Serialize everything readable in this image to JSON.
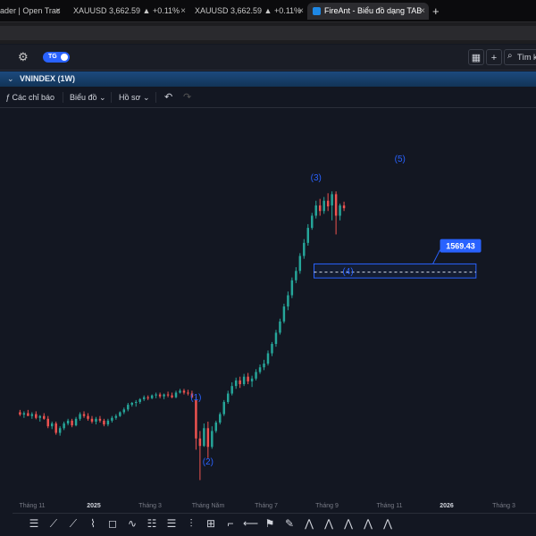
{
  "browser": {
    "tabs": [
      {
        "title": "ader | Open Trac",
        "active": false
      },
      {
        "title": "XAUUSD 3,662.59 ▲ +0.11%",
        "active": false
      },
      {
        "title": "XAUUSD 3,662.59 ▲ +0.11%",
        "active": false
      },
      {
        "title": "FireAnt - Biểu đồ dạng TAB",
        "active": true
      }
    ],
    "close_glyph": "×",
    "new_tab_glyph": "+"
  },
  "toolbar": {
    "toggle_label": "TG",
    "search_label": "Tìm k"
  },
  "symbol": {
    "name": "VNINDEX (1W)"
  },
  "chart_toolbar": {
    "indicators_label": "Các chỉ báo",
    "chart_label": "Biểu đồ",
    "profile_label": "Hồ sơ"
  },
  "chart_data": {
    "type": "candlestick",
    "price_label": "1569.43",
    "zone": {
      "top": 1587,
      "bottom": 1557
    },
    "wave_labels": [
      {
        "text": "(1)",
        "week": 44,
        "price": 1296,
        "color": "#2962ff"
      },
      {
        "text": "(2)",
        "week": 47,
        "price": 1158,
        "color": "#2962ff"
      },
      {
        "text": "(3)",
        "week": 74,
        "price": 1765,
        "color": "#2962ff"
      },
      {
        "text": "(4)",
        "week": 82,
        "price": 1565,
        "color": "#2962ff"
      },
      {
        "text": "(5)",
        "week": 95,
        "price": 1805,
        "color": "#2962ff"
      }
    ],
    "up_color": "#26a69a",
    "down_color": "#ef5350",
    "candles": [
      [
        0,
        1270,
        1275,
        1262,
        1265
      ],
      [
        1,
        1265,
        1272,
        1258,
        1268
      ],
      [
        2,
        1268,
        1275,
        1262,
        1262
      ],
      [
        3,
        1262,
        1270,
        1256,
        1266
      ],
      [
        4,
        1266,
        1272,
        1255,
        1258
      ],
      [
        5,
        1258,
        1264,
        1250,
        1262
      ],
      [
        6,
        1262,
        1268,
        1254,
        1256
      ],
      [
        7,
        1256,
        1262,
        1236,
        1240
      ],
      [
        8,
        1240,
        1250,
        1234,
        1246
      ],
      [
        9,
        1246,
        1250,
        1222,
        1226
      ],
      [
        10,
        1226,
        1240,
        1220,
        1236
      ],
      [
        11,
        1236,
        1250,
        1232,
        1246
      ],
      [
        12,
        1246,
        1256,
        1242,
        1252
      ],
      [
        13,
        1252,
        1256,
        1238,
        1242
      ],
      [
        14,
        1242,
        1260,
        1240,
        1256
      ],
      [
        15,
        1256,
        1270,
        1252,
        1266
      ],
      [
        16,
        1266,
        1272,
        1258,
        1262
      ],
      [
        17,
        1262,
        1268,
        1252,
        1256
      ],
      [
        18,
        1256,
        1262,
        1246,
        1250
      ],
      [
        19,
        1250,
        1260,
        1244,
        1256
      ],
      [
        20,
        1256,
        1262,
        1248,
        1252
      ],
      [
        21,
        1252,
        1256,
        1240,
        1244
      ],
      [
        22,
        1244,
        1256,
        1240,
        1252
      ],
      [
        23,
        1252,
        1262,
        1248,
        1258
      ],
      [
        24,
        1258,
        1266,
        1254,
        1262
      ],
      [
        25,
        1262,
        1272,
        1260,
        1270
      ],
      [
        26,
        1270,
        1280,
        1266,
        1276
      ],
      [
        27,
        1276,
        1290,
        1272,
        1286
      ],
      [
        28,
        1286,
        1292,
        1282,
        1290
      ],
      [
        29,
        1290,
        1296,
        1282,
        1292
      ],
      [
        30,
        1292,
        1300,
        1288,
        1298
      ],
      [
        31,
        1298,
        1306,
        1294,
        1302
      ],
      [
        32,
        1302,
        1306,
        1296,
        1300
      ],
      [
        33,
        1300,
        1308,
        1298,
        1306
      ],
      [
        34,
        1306,
        1312,
        1300,
        1308
      ],
      [
        35,
        1308,
        1312,
        1300,
        1304
      ],
      [
        36,
        1304,
        1310,
        1298,
        1308
      ],
      [
        37,
        1308,
        1314,
        1302,
        1306
      ],
      [
        38,
        1306,
        1312,
        1300,
        1302
      ],
      [
        39,
        1302,
        1316,
        1300,
        1312
      ],
      [
        40,
        1312,
        1320,
        1310,
        1316
      ],
      [
        41,
        1316,
        1320,
        1308,
        1312
      ],
      [
        42,
        1312,
        1318,
        1306,
        1310
      ],
      [
        43,
        1310,
        1316,
        1300,
        1302
      ],
      [
        44,
        1296,
        1304,
        1190,
        1214
      ],
      [
        45,
        1214,
        1230,
        1125,
        1198
      ],
      [
        46,
        1198,
        1246,
        1196,
        1236
      ],
      [
        47,
        1236,
        1250,
        1172,
        1196
      ],
      [
        48,
        1196,
        1240,
        1192,
        1230
      ],
      [
        49,
        1230,
        1252,
        1226,
        1248
      ],
      [
        50,
        1248,
        1270,
        1244,
        1266
      ],
      [
        51,
        1266,
        1296,
        1262,
        1292
      ],
      [
        52,
        1292,
        1316,
        1288,
        1310
      ],
      [
        53,
        1310,
        1334,
        1306,
        1326
      ],
      [
        54,
        1326,
        1344,
        1320,
        1338
      ],
      [
        55,
        1338,
        1346,
        1322,
        1330
      ],
      [
        56,
        1330,
        1352,
        1326,
        1346
      ],
      [
        57,
        1346,
        1354,
        1330,
        1336
      ],
      [
        58,
        1336,
        1348,
        1324,
        1342
      ],
      [
        59,
        1342,
        1362,
        1338,
        1356
      ],
      [
        60,
        1356,
        1372,
        1352,
        1366
      ],
      [
        61,
        1366,
        1382,
        1360,
        1374
      ],
      [
        62,
        1374,
        1402,
        1370,
        1396
      ],
      [
        63,
        1396,
        1420,
        1390,
        1416
      ],
      [
        64,
        1416,
        1446,
        1410,
        1440
      ],
      [
        65,
        1440,
        1470,
        1436,
        1464
      ],
      [
        66,
        1464,
        1502,
        1460,
        1496
      ],
      [
        67,
        1496,
        1528,
        1488,
        1520
      ],
      [
        68,
        1520,
        1558,
        1514,
        1552
      ],
      [
        69,
        1552,
        1580,
        1546,
        1572
      ],
      [
        70,
        1572,
        1610,
        1566,
        1604
      ],
      [
        71,
        1604,
        1640,
        1598,
        1632
      ],
      [
        72,
        1632,
        1672,
        1626,
        1664
      ],
      [
        73,
        1664,
        1696,
        1660,
        1690
      ],
      [
        74,
        1690,
        1722,
        1684,
        1712
      ],
      [
        75,
        1712,
        1726,
        1690,
        1700
      ],
      [
        76,
        1700,
        1730,
        1694,
        1722
      ],
      [
        77,
        1722,
        1738,
        1700,
        1710
      ],
      [
        78,
        1712,
        1742,
        1680,
        1736
      ],
      [
        79,
        1736,
        1742,
        1650,
        1690
      ],
      [
        80,
        1690,
        1716,
        1680,
        1712
      ],
      [
        81,
        1712,
        1720,
        1700,
        1706
      ]
    ],
    "ylim": [
      1080,
      1920
    ],
    "xlim": [
      -5,
      129
    ],
    "x_ticks": [
      {
        "label": "Tháng 11",
        "week": -3,
        "bold": false
      },
      {
        "label": "2025",
        "week": 6,
        "bold": true
      },
      {
        "label": "Tháng 3",
        "week": 23,
        "bold": false
      },
      {
        "label": "Tháng Năm",
        "week": 32,
        "bold": false
      },
      {
        "label": "Tháng 7",
        "week": 41,
        "bold": false
      },
      {
        "label": "Tháng 9",
        "week": 50,
        "bold": false
      },
      {
        "label": "Tháng 11",
        "week": 59,
        "bold": false
      },
      {
        "label": "2026",
        "week": 68,
        "bold": true
      },
      {
        "label": "Tháng 3",
        "week": 77,
        "bold": false
      }
    ]
  },
  "icons": {
    "gear": "settings-gear-icon",
    "layout": "grid-layout-icon",
    "add": "plus-icon",
    "undo": "undo-icon",
    "redo": "redo-icon"
  }
}
